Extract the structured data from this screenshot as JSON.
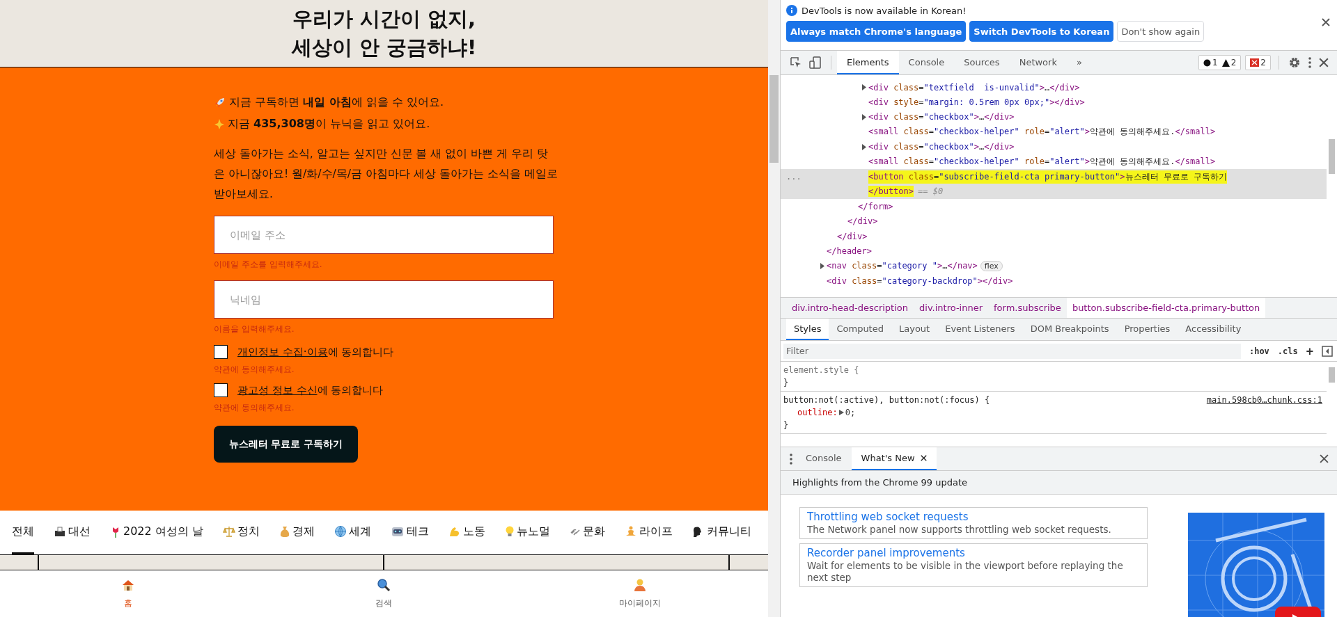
{
  "page": {
    "headline": [
      "우리가 시간이 없지,",
      "세상이 안 궁금하냐!"
    ],
    "intro_lines": [
      "지금 구독하면 **내일 아침**에 읽을 수 있어요.",
      "지금 **435,308명**이 뉴닉을 읽고 있어요."
    ],
    "description": "세상 돌아가는 소식, 알고는 싶지만 신문 볼 새 없이 바쁜 게 우리 탓은 아니잖아요! 월/화/수/목/금 아침마다 세상 돌아가는 소식을 메일로 받아보세요.",
    "fields": [
      {
        "placeholder": "이메일 주소",
        "error": "이메일 주소를 입력해주세요."
      },
      {
        "placeholder": "닉네임",
        "error": "이름을 입력해주세요."
      }
    ],
    "agreements": [
      {
        "checked": false,
        "link": "개인정보 수집·이용",
        "suffix": "에 동의합니다",
        "error": "약관에 동의해주세요."
      },
      {
        "checked": false,
        "link": "광고성 정보 수신",
        "suffix": "에 동의합니다",
        "error": "약관에 동의해주세요."
      }
    ],
    "submit": "뉴스레터 무료로 구독하기",
    "categories": [
      {
        "label": "전체",
        "selected": true
      },
      {
        "label": "대선",
        "selected": false
      },
      {
        "label": "2022 여성의 날",
        "selected": false
      },
      {
        "label": "정치",
        "selected": false
      },
      {
        "label": "경제",
        "selected": false
      },
      {
        "label": "세계",
        "selected": false
      },
      {
        "label": "테크",
        "selected": false
      },
      {
        "label": "노동",
        "selected": false
      },
      {
        "label": "뉴노멀",
        "selected": false
      },
      {
        "label": "문화",
        "selected": false
      },
      {
        "label": "라이프",
        "selected": false
      },
      {
        "label": "커뮤니티",
        "selected": false
      }
    ],
    "bottom_nav": [
      {
        "label": "홈",
        "selected": true
      },
      {
        "label": "검색",
        "selected": false
      },
      {
        "label": "마이페이지",
        "selected": false
      }
    ]
  },
  "devtools": {
    "infobar": {
      "message": "DevTools is now available in Korean!",
      "buttons": [
        {
          "label": "Always match Chrome's language",
          "kind": "primary"
        },
        {
          "label": "Switch DevTools to Korean",
          "kind": "primary"
        },
        {
          "label": "Don't show again",
          "kind": "secondary"
        }
      ]
    },
    "panel_tabs": [
      {
        "label": "Elements",
        "selected": true
      },
      {
        "label": "Console",
        "selected": false
      },
      {
        "label": "Sources",
        "selected": false
      },
      {
        "label": "Network",
        "selected": false
      }
    ],
    "more_tabs": "»",
    "counter_groups": [
      [
        {
          "kind": "error",
          "count": "1"
        },
        {
          "kind": "warning",
          "count": "2"
        }
      ],
      [
        {
          "kind": "issue",
          "count": "2"
        }
      ]
    ],
    "tree": [
      {
        "close": "</header>",
        "selected": false,
        "children": [
          {
            "close": "</div>",
            "selected": false,
            "children": [
              {
                "close": "</div>",
                "selected": false,
                "children": [
                  {
                    "close": "</form>",
                    "selected": false,
                    "children": [
                      {
                        "open": "<div class=\"textfield  is-unvalid\">…</div>",
                        "expandable": true,
                        "selected": false
                      },
                      {
                        "open": "<div style=\"margin: 0.5rem 0px 0px;\"></div>",
                        "expandable": false,
                        "selected": false
                      },
                      {
                        "open": "<div class=\"checkbox\">…</div>",
                        "expandable": true,
                        "selected": false
                      },
                      {
                        "open": "<small class=\"checkbox-helper\" role=\"alert\">약관에 동의해주세요.</small>",
                        "expandable": false,
                        "selected": false
                      },
                      {
                        "open": "<div class=\"checkbox\">…</div>",
                        "expandable": true,
                        "selected": false
                      },
                      {
                        "open": "<small class=\"checkbox-helper\" role=\"alert\">약관에 동의해주세요.</small>",
                        "expandable": false,
                        "selected": false
                      },
                      {
                        "open": "<button class=\"subscribe-field-cta primary-button\">뉴스레터 무료로 구독하기",
                        "close": "</button>",
                        "ref": "== $0",
                        "gutter": "...",
                        "expandable": false,
                        "selected": true
                      }
                    ]
                  }
                ]
              }
            ]
          }
        ]
      },
      {
        "open": "<nav class=\"category \">…</nav>",
        "badge": "flex",
        "expandable": true,
        "selected": false
      },
      {
        "open": "<div class=\"category-backdrop\"></div>",
        "expandable": false,
        "selected": false
      }
    ],
    "breadcrumbs": [
      {
        "label": "div.intro-head-description",
        "selected": false
      },
      {
        "label": "div.intro-inner",
        "selected": false
      },
      {
        "label": "form.subscribe",
        "selected": false
      },
      {
        "label": "button.subscribe-field-cta.primary-button",
        "selected": true
      }
    ],
    "sidebar_tabs": [
      {
        "label": "Styles",
        "selected": true
      },
      {
        "label": "Computed",
        "selected": false
      },
      {
        "label": "Layout",
        "selected": false
      },
      {
        "label": "Event Listeners",
        "selected": false
      },
      {
        "label": "DOM Breakpoints",
        "selected": false
      },
      {
        "label": "Properties",
        "selected": false
      },
      {
        "label": "Accessibility",
        "selected": false
      }
    ],
    "filter": {
      "placeholder": "Filter"
    },
    "filter_tools": [
      ":hov",
      ".cls"
    ],
    "add_rule": "+",
    "rules": [
      {
        "selector": "element.style {",
        "close": "}"
      },
      {
        "selector": "button:not(:active), button:not(:focus) {",
        "source": "main.598cb0…chunk.css:1",
        "close": "}",
        "properties": [
          {
            "name": "outline:",
            "value": "0;"
          }
        ]
      }
    ],
    "drawer": {
      "tabs": [
        {
          "label": "Console",
          "selected": false,
          "closable": false
        },
        {
          "label": "What's New",
          "selected": true,
          "closable": true
        }
      ],
      "heading": "Highlights from the Chrome 99 update",
      "items": [
        {
          "title": "Throttling web socket requests",
          "description": "The Network panel now supports throttling web socket requests."
        },
        {
          "title": "Recorder panel improvements",
          "description": "Wait for elements to be visible in the viewport before replaying the next step"
        }
      ]
    }
  }
}
